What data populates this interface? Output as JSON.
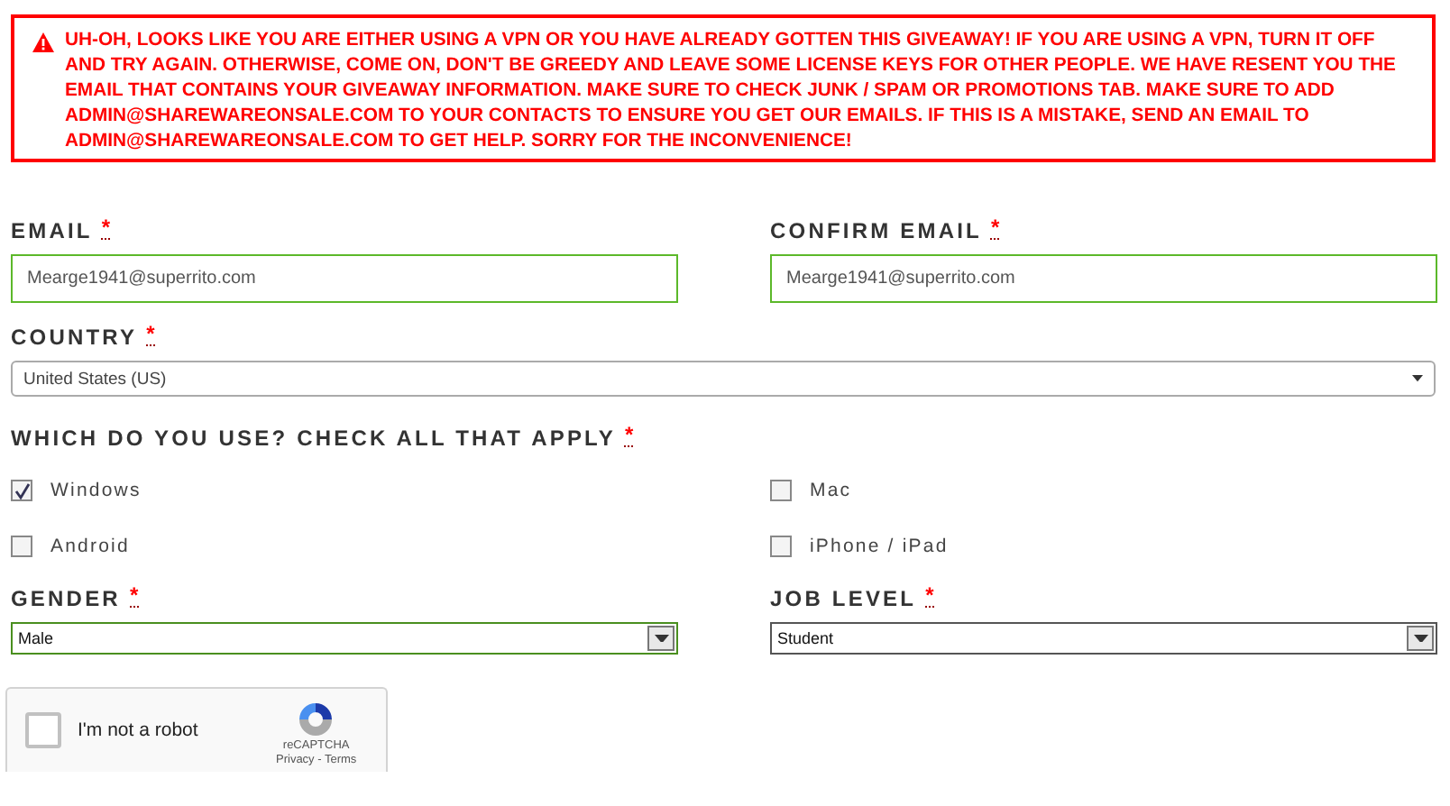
{
  "alert": {
    "text": "UH-OH, LOOKS LIKE YOU ARE EITHER USING A VPN OR YOU HAVE ALREADY GOTTEN THIS GIVEAWAY! IF YOU ARE USING A VPN, TURN IT OFF AND TRY AGAIN. OTHERWISE, COME ON, DON'T BE GREEDY AND LEAVE SOME LICENSE KEYS FOR OTHER PEOPLE. WE HAVE RESENT YOU THE EMAIL THAT CONTAINS YOUR GIVEAWAY INFORMATION. MAKE SURE TO CHECK JUNK / SPAM OR PROMOTIONS TAB. MAKE SURE TO ADD ADMIN@SHAREWAREONSALE.COM TO YOUR CONTACTS TO ENSURE YOU GET OUR EMAILS. IF THIS IS A MISTAKE, SEND AN EMAIL TO ADMIN@SHAREWAREONSALE.COM TO GET HELP. SORRY FOR THE INCONVENIENCE!"
  },
  "email": {
    "label": "EMAIL",
    "required_mark": "*",
    "value": "Mearge1941@superrito.com"
  },
  "confirm_email": {
    "label": "CONFIRM EMAIL",
    "required_mark": "*",
    "value": "Mearge1941@superrito.com"
  },
  "country": {
    "label": "COUNTRY",
    "required_mark": "*",
    "value": "United States (US)"
  },
  "platforms": {
    "label": "WHICH DO YOU USE? CHECK ALL THAT APPLY",
    "required_mark": "*",
    "options": [
      {
        "label": "Windows",
        "checked": true
      },
      {
        "label": "Mac",
        "checked": false
      },
      {
        "label": "Android",
        "checked": false
      },
      {
        "label": "iPhone / iPad",
        "checked": false
      }
    ]
  },
  "gender": {
    "label": "GENDER",
    "required_mark": "*",
    "value": "Male",
    "focused": true
  },
  "job_level": {
    "label": "JOB LEVEL",
    "required_mark": "*",
    "value": "Student",
    "focused": false
  },
  "captcha": {
    "label": "I'm not a robot",
    "checked": false,
    "brand": "reCAPTCHA",
    "links": "Privacy - Terms"
  }
}
